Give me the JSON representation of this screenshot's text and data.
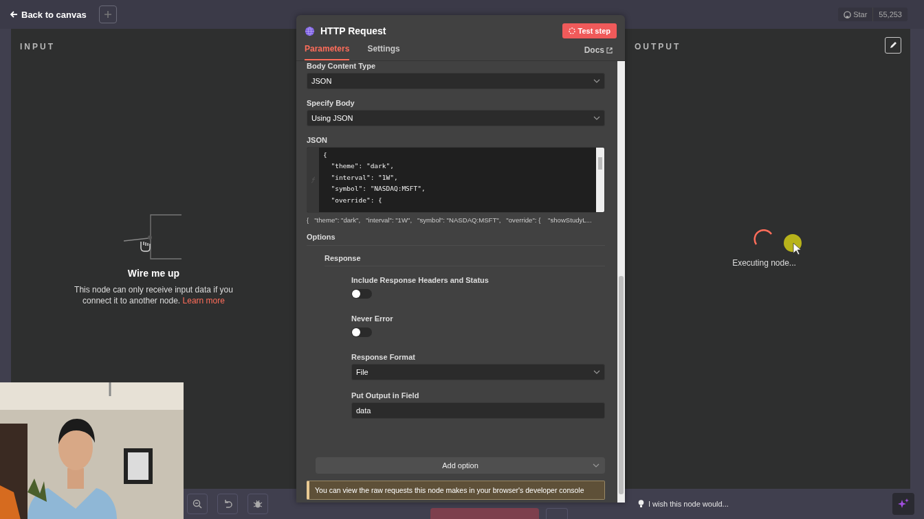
{
  "top_bar": {
    "back_link": "Back to canvas",
    "github": {
      "label": "Star",
      "count": "55,253"
    }
  },
  "input_panel": {
    "title": "INPUT",
    "heading": "Wire me up",
    "message": "This node can only receive input data if you connect it to another node.",
    "link": "Learn more"
  },
  "node": {
    "title": "HTTP Request",
    "test_button": "Test step",
    "tabs": [
      {
        "label": "Parameters",
        "selected": true
      },
      {
        "label": "Settings",
        "selected": false
      }
    ],
    "docs_link": "Docs",
    "fields": [
      {
        "kind": "select",
        "label": "Body Content Type",
        "value": "JSON"
      },
      {
        "kind": "select",
        "label": "Specify Body",
        "value": "Using JSON"
      }
    ],
    "json_editor": {
      "label": "JSON",
      "lines": [
        "{",
        "  \"theme\": \"dark\",",
        "  \"interval\": \"1W\",",
        "  \"symbol\": \"NASDAQ:MSFT\",",
        "  \"override\": {"
      ],
      "preview": "{   \"theme\": \"dark\",   \"interval\": \"1W\",   \"symbol\": \"NASDAQ:MSFT\",   \"override\": {    \"showStudyL..."
    },
    "options": {
      "label": "Options",
      "group": "Response",
      "items": [
        {
          "kind": "toggle",
          "label": "Include Response Headers and Status",
          "on": false
        },
        {
          "kind": "toggle",
          "label": "Never Error",
          "on": false
        },
        {
          "kind": "select",
          "label": "Response Format",
          "value": "File"
        },
        {
          "kind": "input",
          "label": "Put Output in Field",
          "value": "data"
        }
      ],
      "add_button": "Add option"
    },
    "notice": "You can view the raw requests this node makes in your browser's developer console"
  },
  "output_panel": {
    "title": "OUTPUT",
    "status": "Executing node..."
  },
  "feedback": {
    "placeholder": "I wish this node would..."
  }
}
